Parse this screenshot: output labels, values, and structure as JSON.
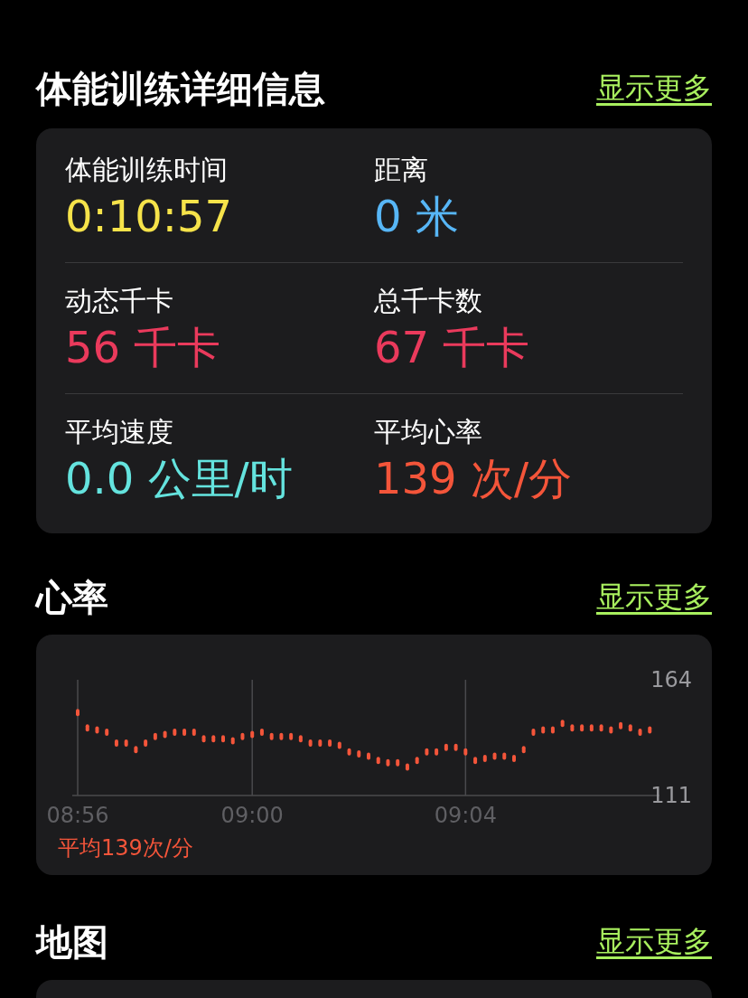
{
  "workout_details": {
    "title": "体能训练详细信息",
    "show_more": "显示更多",
    "metrics": [
      {
        "label": "体能训练时间",
        "value": "0:10:57",
        "color": "#f6e34a"
      },
      {
        "label": "距离",
        "value": "0 米",
        "color": "#57b6f6"
      },
      {
        "label": "动态千卡",
        "value": "56 千卡",
        "color": "#ea3a5c"
      },
      {
        "label": "总千卡数",
        "value": "67 千卡",
        "color": "#ea3a5c"
      },
      {
        "label": "平均速度",
        "value": "0.0 公里/时",
        "color": "#64e3de"
      },
      {
        "label": "平均心率",
        "value": "139 次/分",
        "color": "#f4553a"
      }
    ]
  },
  "heart_rate": {
    "title": "心率",
    "show_more": "显示更多",
    "average": "平均139次/分",
    "chart_data": {
      "type": "scatter",
      "grid": true,
      "ylim": [
        111,
        164
      ],
      "yticks": [
        111,
        164
      ],
      "categories": [
        "08:56",
        null,
        null,
        null,
        null,
        null,
        null,
        null,
        null,
        null,
        null,
        null,
        null,
        null,
        null,
        null,
        null,
        null,
        "09:00",
        null,
        null,
        null,
        null,
        null,
        null,
        null,
        null,
        null,
        null,
        null,
        null,
        null,
        null,
        null,
        null,
        null,
        null,
        null,
        null,
        null,
        "09:04",
        null,
        null,
        null,
        null,
        null,
        null,
        null,
        null,
        null,
        null,
        null,
        null,
        null,
        null,
        null,
        null,
        null,
        null,
        null
      ],
      "series": [
        {
          "color": "#f4553a",
          "values": [
            149,
            142,
            141,
            140,
            135,
            135,
            132,
            135,
            138,
            139,
            140,
            140,
            140,
            137,
            137,
            137,
            136,
            138,
            139,
            140,
            138,
            138,
            138,
            137,
            135,
            135,
            135,
            134,
            131,
            130,
            129,
            127,
            126,
            126,
            124,
            127,
            131,
            131,
            133,
            133,
            131,
            127,
            128,
            129,
            129,
            128,
            132,
            140,
            141,
            141,
            144,
            142,
            142,
            142,
            142,
            141,
            143,
            142,
            140,
            141
          ]
        }
      ]
    }
  },
  "map": {
    "title": "地图",
    "show_more": "显示更多"
  }
}
